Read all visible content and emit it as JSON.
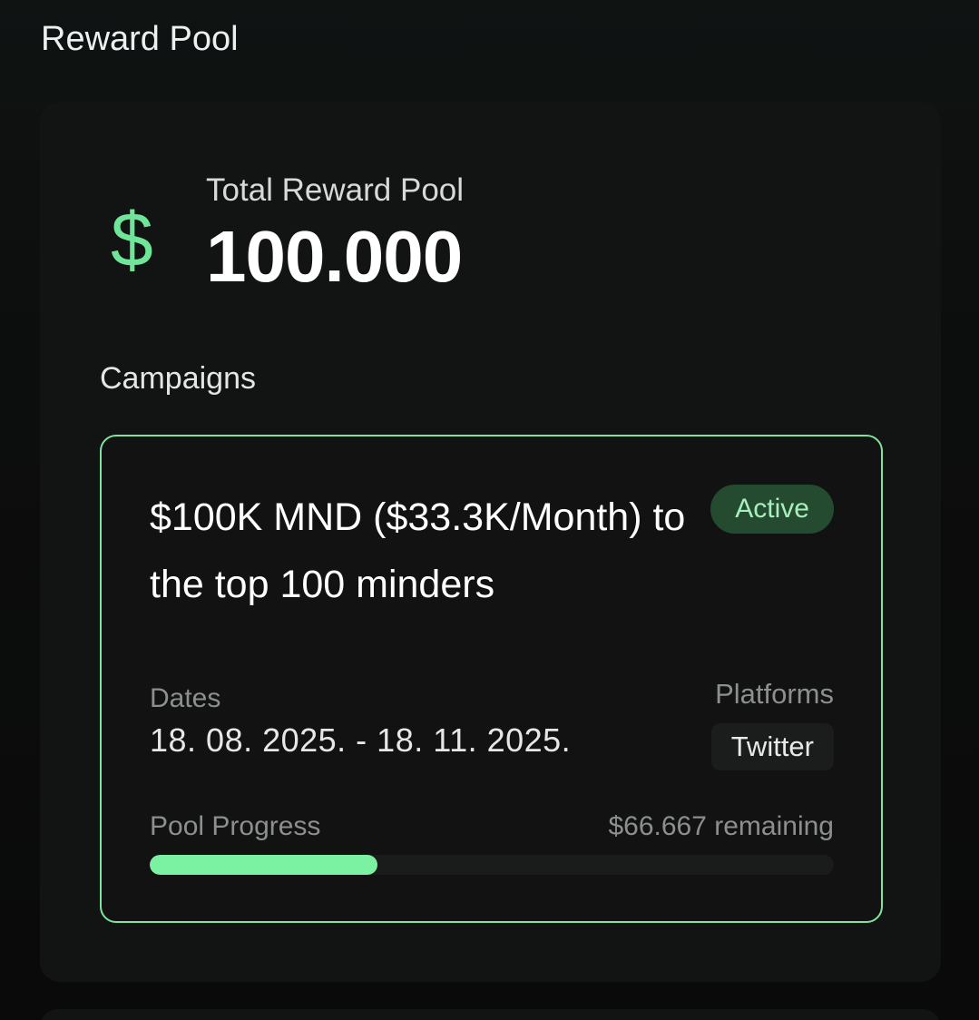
{
  "header": {
    "title": "Reward Pool"
  },
  "pool": {
    "icon": "dollar-icon",
    "total_label": "Total Reward Pool",
    "total_value": "100.000",
    "accent_color": "#6fe59a"
  },
  "campaigns": {
    "label": "Campaigns",
    "items": [
      {
        "title": "$100K MND ($33.3K/Month) to the top 100 minders",
        "status": "Active",
        "dates_label": "Dates",
        "dates_value": "18. 08. 2025. - 18. 11. 2025.",
        "platforms_label": "Platforms",
        "platform": "Twitter",
        "progress_label": "Pool Progress",
        "remaining": "$66.667 remaining",
        "progress_fraction": 0.3333
      }
    ]
  }
}
